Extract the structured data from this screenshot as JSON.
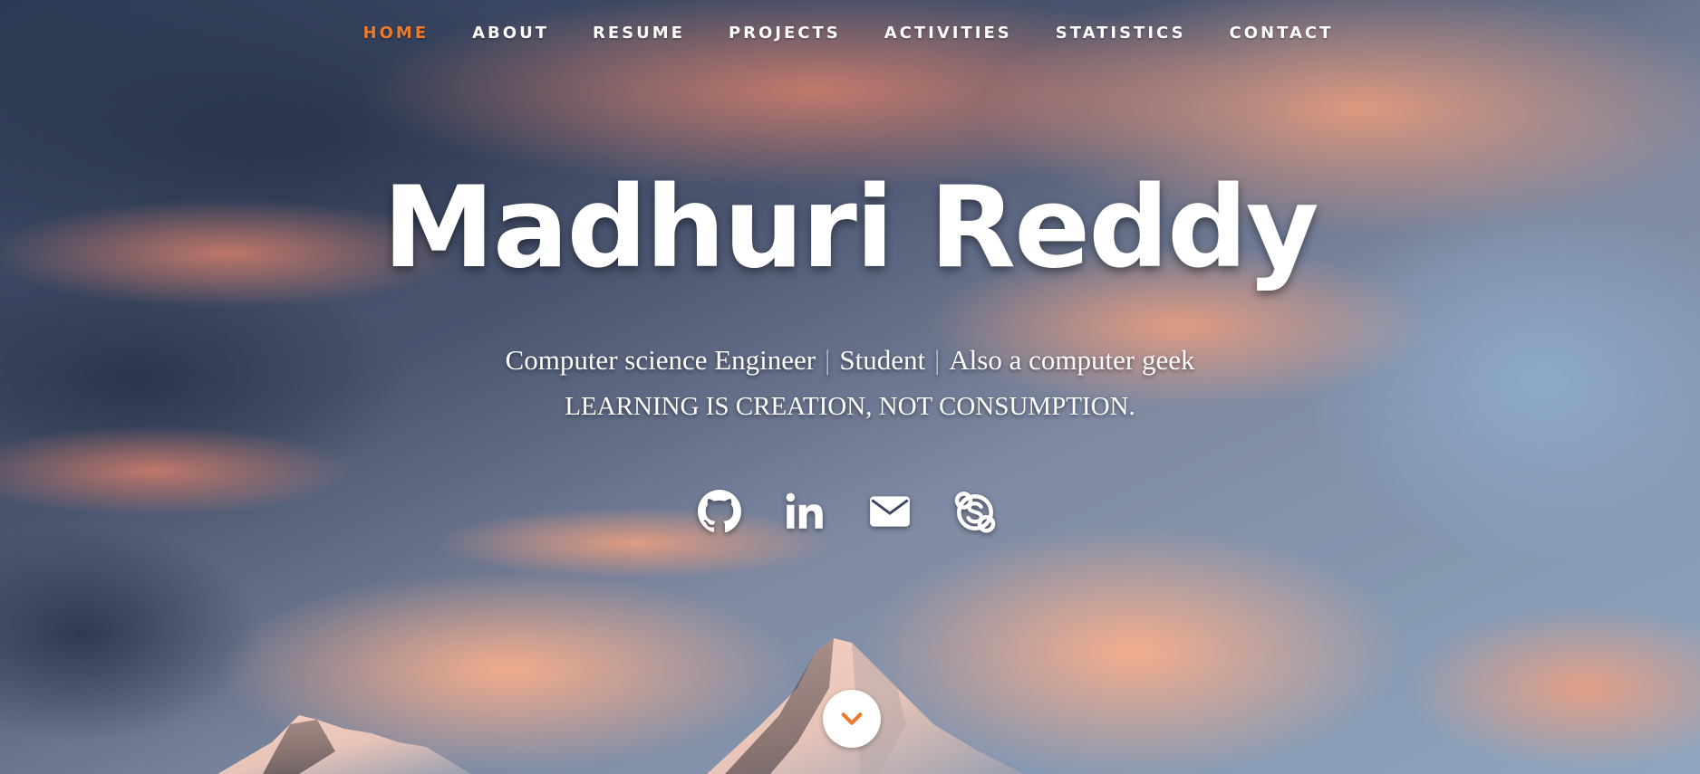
{
  "nav": {
    "items": [
      {
        "label": "HOME",
        "active": true
      },
      {
        "label": "ABOUT",
        "active": false
      },
      {
        "label": "RESUME",
        "active": false
      },
      {
        "label": "PROJECTS",
        "active": false
      },
      {
        "label": "ACTIVITIES",
        "active": false
      },
      {
        "label": "STATISTICS",
        "active": false
      },
      {
        "label": "CONTACT",
        "active": false
      }
    ],
    "active_color": "#ec7a2a"
  },
  "banner": {
    "name": "Madhuri Reddy",
    "tagline": [
      "Computer science Engineer",
      "Student",
      "Also a computer geek"
    ],
    "separator": "|",
    "motto": "LEARNING IS CREATION, NOT CONSUMPTION."
  },
  "social": [
    {
      "icon": "github-icon"
    },
    {
      "icon": "linkedin-icon"
    },
    {
      "icon": "envelope-icon"
    },
    {
      "icon": "skype-icon"
    }
  ],
  "scroll": {
    "icon": "chevron-down-icon"
  },
  "colors": {
    "text": "#ffffff",
    "accent": "#ec7a2a",
    "chevron": "#ec7a2a"
  }
}
